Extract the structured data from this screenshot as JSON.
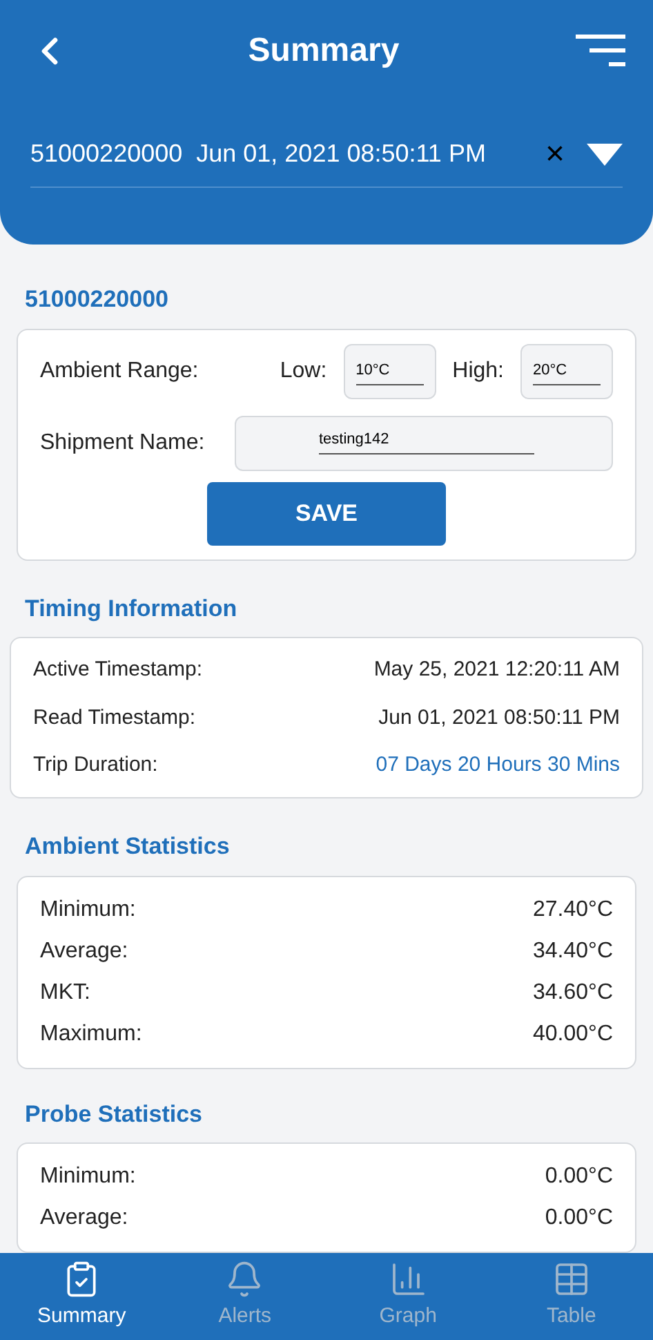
{
  "header": {
    "title": "Summary",
    "selector": "51000220000  Jun 01, 2021 08:50:11 PM",
    "clear": "×"
  },
  "device": {
    "heading": "51000220000",
    "ambient_range_label": "Ambient Range:",
    "low_label": "Low:",
    "low_value": "10°C",
    "high_label": "High:",
    "high_value": "20°C",
    "shipment_label": "Shipment Name:",
    "shipment_value": "testing142",
    "save": "SAVE"
  },
  "timing": {
    "heading": "Timing Information",
    "rows": [
      {
        "label": "Active Timestamp:",
        "value": "May 25, 2021 12:20:11 AM",
        "highlight": false
      },
      {
        "label": "Read Timestamp:",
        "value": "Jun 01, 2021 08:50:11 PM",
        "highlight": false
      },
      {
        "label": "Trip Duration:",
        "value": "07 Days 20 Hours 30 Mins",
        "highlight": true
      }
    ]
  },
  "ambient": {
    "heading": "Ambient Statistics",
    "rows": [
      {
        "label": "Minimum:",
        "value": "27.40°C"
      },
      {
        "label": "Average:",
        "value": "34.40°C"
      },
      {
        "label": "MKT:",
        "value": "34.60°C"
      },
      {
        "label": "Maximum:",
        "value": "40.00°C"
      }
    ]
  },
  "probe": {
    "heading": "Probe Statistics",
    "rows": [
      {
        "label": "Minimum:",
        "value": "0.00°C"
      },
      {
        "label": "Average:",
        "value": "0.00°C"
      }
    ]
  },
  "tabs": [
    {
      "label": "Summary",
      "kind": "clipboard",
      "selected": true
    },
    {
      "label": "Alerts",
      "kind": "bell",
      "selected": false
    },
    {
      "label": "Graph",
      "kind": "chart",
      "selected": false
    },
    {
      "label": "Table",
      "kind": "table",
      "selected": false
    }
  ]
}
